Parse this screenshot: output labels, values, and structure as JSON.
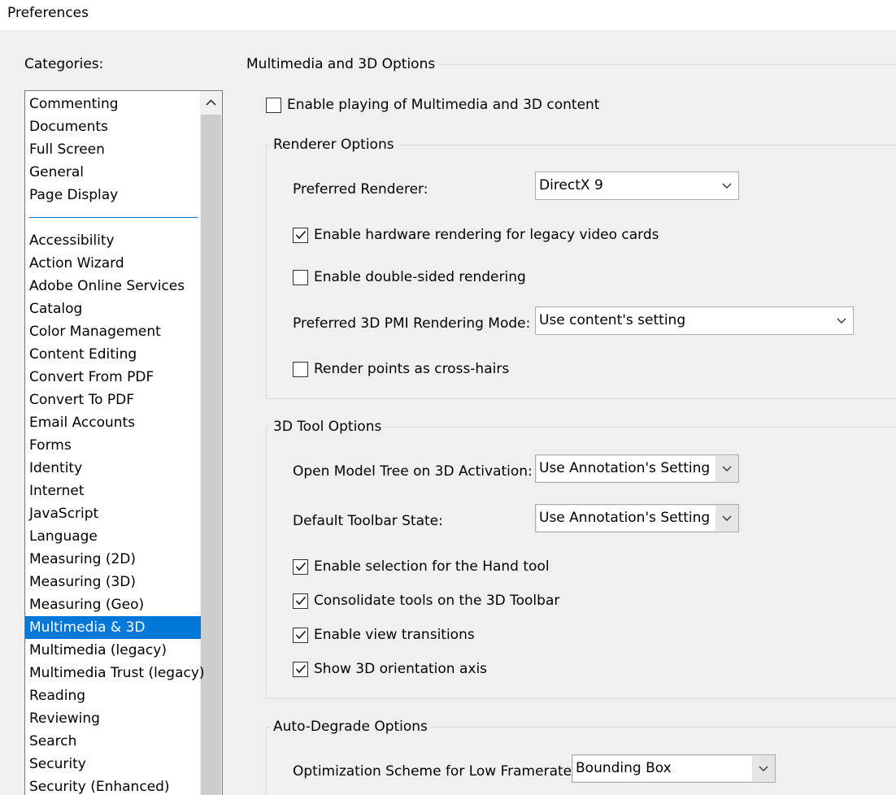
{
  "window": {
    "title": "Preferences"
  },
  "categories": {
    "label": "Categories:",
    "top_items": [
      "Commenting",
      "Documents",
      "Full Screen",
      "General",
      "Page Display"
    ],
    "items": [
      "Accessibility",
      "Action Wizard",
      "Adobe Online Services",
      "Catalog",
      "Color Management",
      "Content Editing",
      "Convert From PDF",
      "Convert To PDF",
      "Email Accounts",
      "Forms",
      "Identity",
      "Internet",
      "JavaScript",
      "Language",
      "Measuring (2D)",
      "Measuring (3D)",
      "Measuring (Geo)",
      "Multimedia & 3D",
      "Multimedia (legacy)",
      "Multimedia Trust (legacy)",
      "Reading",
      "Reviewing",
      "Search",
      "Security",
      "Security (Enhanced)"
    ],
    "selected": "Multimedia & 3D"
  },
  "main": {
    "section_title": "Multimedia and 3D Options",
    "enable_playing": {
      "label": "Enable playing of Multimedia and 3D content",
      "checked": false
    },
    "renderer": {
      "title": "Renderer Options",
      "preferred_renderer_label": "Preferred Renderer:",
      "preferred_renderer_value": "DirectX 9",
      "hw_legacy": {
        "label": "Enable hardware rendering for legacy video cards",
        "checked": true
      },
      "double_sided": {
        "label": "Enable double-sided rendering",
        "checked": false
      },
      "pmi_label": "Preferred 3D PMI Rendering Mode:",
      "pmi_value": "Use content's setting",
      "cross_hairs": {
        "label": "Render points as cross-hairs",
        "checked": false
      }
    },
    "tool": {
      "title": "3D Tool Options",
      "model_tree_label": "Open Model Tree on 3D Activation:",
      "model_tree_value": "Use Annotation's Setting",
      "toolbar_state_label": "Default Toolbar State:",
      "toolbar_state_value": "Use Annotation's Setting",
      "hand_tool": {
        "label": "Enable selection for the Hand tool",
        "checked": true
      },
      "consolidate": {
        "label": "Consolidate tools on the 3D Toolbar",
        "checked": true
      },
      "view_transitions": {
        "label": "Enable view transitions",
        "checked": true
      },
      "orientation_axis": {
        "label": "Show 3D orientation axis",
        "checked": true
      }
    },
    "degrade": {
      "title": "Auto-Degrade Options",
      "scheme_label": "Optimization Scheme for Low Framerate:",
      "scheme_value": "Bounding Box"
    }
  },
  "icons": {
    "check": "checkmark-icon",
    "dropdown": "chevron-down-icon",
    "scroll_up": "chevron-up-icon"
  },
  "colors": {
    "selection": "#0078d7",
    "background": "#f0f0f0"
  }
}
